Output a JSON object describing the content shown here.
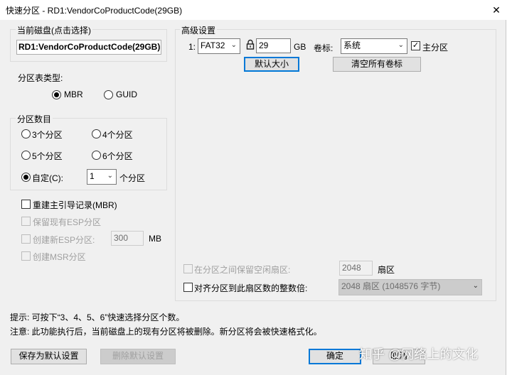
{
  "window": {
    "title": "快速分区 - RD1:VendorCoProductCode(29GB)"
  },
  "current_disk": {
    "group_label": "当前磁盘(点击选择)",
    "value": "RD1:VendorCoProductCode(29GB)"
  },
  "partition_table": {
    "label": "分区表类型:",
    "options": [
      "MBR",
      "GUID"
    ],
    "selected": "MBR"
  },
  "partition_count": {
    "group_label": "分区数目",
    "options": [
      "3个分区",
      "4个分区",
      "5个分区",
      "6个分区"
    ],
    "custom_label": "自定(C):",
    "custom_value": "1",
    "custom_suffix": "个分区",
    "selected": "自定(C):"
  },
  "options": {
    "rebuild_mbr": "重建主引导记录(MBR)",
    "keep_esp": "保留现有ESP分区",
    "create_esp": "创建新ESP分区:",
    "esp_size": "300",
    "esp_unit": "MB",
    "create_msr": "创建MSR分区"
  },
  "advanced": {
    "group_label": "高级设置",
    "index": "1:",
    "fs": "FAT32",
    "size": "29",
    "size_unit": "GB",
    "volume_label_text": "卷标:",
    "volume_label": "系统",
    "primary_label": "主分区",
    "primary_checked": true,
    "default_size_button": "默认大小",
    "clear_labels_button": "清空所有卷标",
    "gap_label": "在分区之间保留空闲扇区:",
    "gap_value": "2048",
    "gap_unit": "扇区",
    "align_label": "对齐分区到此扇区数的整数倍:",
    "align_value": "2048 扇区 (1048576 字节)"
  },
  "hints": {
    "tip": "提示: 可按下“3、4、5、6”快速选择分区个数。",
    "note": "注意: 此功能执行后，当前磁盘上的现有分区将被删除。新分区将会被快速格式化。"
  },
  "buttons": {
    "save_default": "保存为默认设置",
    "delete_default": "删除默认设置",
    "ok": "确定",
    "cancel": "取消"
  },
  "watermark": "知乎 @网络上的文化"
}
